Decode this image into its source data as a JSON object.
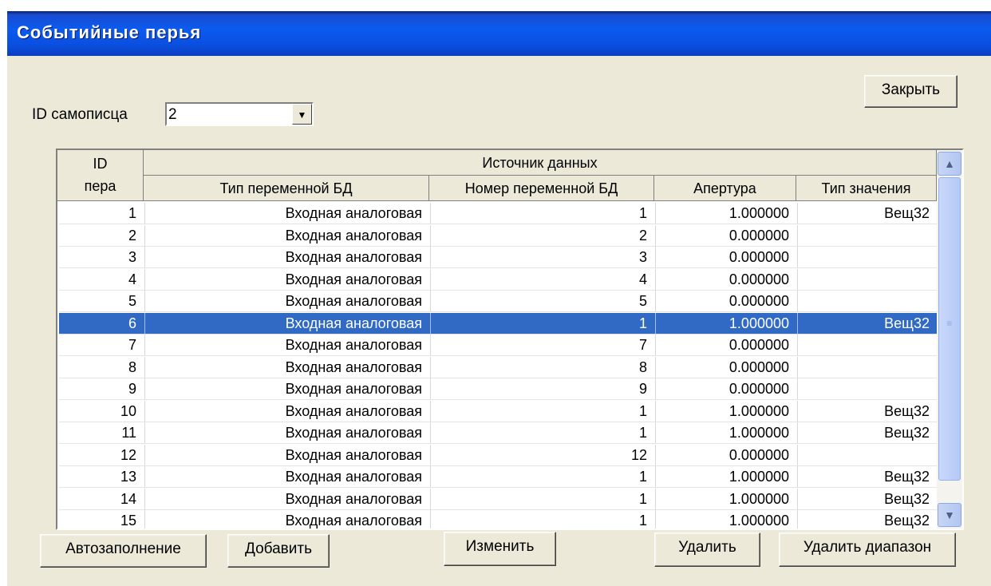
{
  "window": {
    "title": "Событийные перья"
  },
  "close_label": "Закрыть",
  "recorder": {
    "label": "ID самописца",
    "value": "2"
  },
  "table": {
    "col_id": "ID\nпера",
    "group_header": "Источник данных",
    "columns": [
      "Тип переменной БД",
      "Номер переменной БД",
      "Апертура",
      "Тип значения"
    ],
    "rows": [
      {
        "id": "1",
        "type": "Входная аналоговая",
        "num": "1",
        "ap": "1.000000",
        "vt": "Вещ32"
      },
      {
        "id": "2",
        "type": "Входная аналоговая",
        "num": "2",
        "ap": "0.000000",
        "vt": ""
      },
      {
        "id": "3",
        "type": "Входная аналоговая",
        "num": "3",
        "ap": "0.000000",
        "vt": ""
      },
      {
        "id": "4",
        "type": "Входная аналоговая",
        "num": "4",
        "ap": "0.000000",
        "vt": ""
      },
      {
        "id": "5",
        "type": "Входная аналоговая",
        "num": "5",
        "ap": "0.000000",
        "vt": ""
      },
      {
        "id": "6",
        "type": "Входная аналоговая",
        "num": "1",
        "ap": "1.000000",
        "vt": "Вещ32"
      },
      {
        "id": "7",
        "type": "Входная аналоговая",
        "num": "7",
        "ap": "0.000000",
        "vt": ""
      },
      {
        "id": "8",
        "type": "Входная аналоговая",
        "num": "8",
        "ap": "0.000000",
        "vt": ""
      },
      {
        "id": "9",
        "type": "Входная аналоговая",
        "num": "9",
        "ap": "0.000000",
        "vt": ""
      },
      {
        "id": "10",
        "type": "Входная аналоговая",
        "num": "1",
        "ap": "1.000000",
        "vt": "Вещ32"
      },
      {
        "id": "11",
        "type": "Входная аналоговая",
        "num": "1",
        "ap": "1.000000",
        "vt": "Вещ32"
      },
      {
        "id": "12",
        "type": "Входная аналоговая",
        "num": "12",
        "ap": "0.000000",
        "vt": ""
      },
      {
        "id": "13",
        "type": "Входная аналоговая",
        "num": "1",
        "ap": "1.000000",
        "vt": "Вещ32"
      },
      {
        "id": "14",
        "type": "Входная аналоговая",
        "num": "1",
        "ap": "1.000000",
        "vt": "Вещ32"
      },
      {
        "id": "15",
        "type": "Входная аналоговая",
        "num": "1",
        "ap": "1.000000",
        "vt": "Вещ32"
      }
    ],
    "selected_id": "6"
  },
  "buttons": {
    "autofill": "Автозаполнение",
    "add": "Добавить",
    "edit": "Изменить",
    "delete": "Удалить",
    "delete_range": "Удалить диапазон"
  }
}
